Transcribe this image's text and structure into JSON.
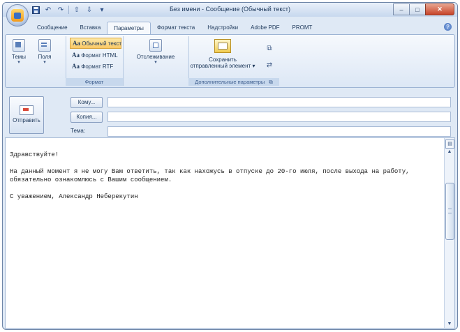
{
  "window": {
    "title": "Без имени - Сообщение (Обычный текст)"
  },
  "qat": {
    "save_icon": "save-icon",
    "undo_icon": "undo-icon",
    "redo_icon": "redo-icon"
  },
  "window_controls": {
    "minimize": "–",
    "maximize": "□",
    "close": "✕"
  },
  "tabs": [
    {
      "label": "Сообщение"
    },
    {
      "label": "Вставка"
    },
    {
      "label": "Параметры",
      "active": true
    },
    {
      "label": "Формат текста"
    },
    {
      "label": "Надстройки"
    },
    {
      "label": "Adobe PDF"
    },
    {
      "label": "PROMT"
    }
  ],
  "ribbon": {
    "themes_label": "Темы",
    "fields_label": "Поля",
    "format": {
      "items": [
        {
          "prefix": "Aa",
          "label": "Обычный текст",
          "selected": true
        },
        {
          "prefix": "Aa",
          "label": "Формат HTML"
        },
        {
          "prefix": "Aa",
          "label": "Формат RTF"
        }
      ],
      "group_label": "Формат"
    },
    "tracking_label": "Отслеживание",
    "save_line1": "Сохранить",
    "save_line2": "отправленный элемент ▾",
    "more_group_label": "Дополнительные параметры"
  },
  "header": {
    "send_label": "Отправить",
    "to_label": "Кому...",
    "cc_label": "Копия...",
    "subject_label": "Тема:",
    "to_value": "",
    "cc_value": "",
    "subject_value": ""
  },
  "message": {
    "lines": [
      "Здравствуйте!",
      "",
      "На данный момент я не могу Вам ответить, так как нахожусь в отпуске до 20-го июля, после выхода на работу, обязательно ознакомлюсь с Вашим сообщением.",
      "",
      "С уважением, Александр Неберекутин"
    ]
  }
}
